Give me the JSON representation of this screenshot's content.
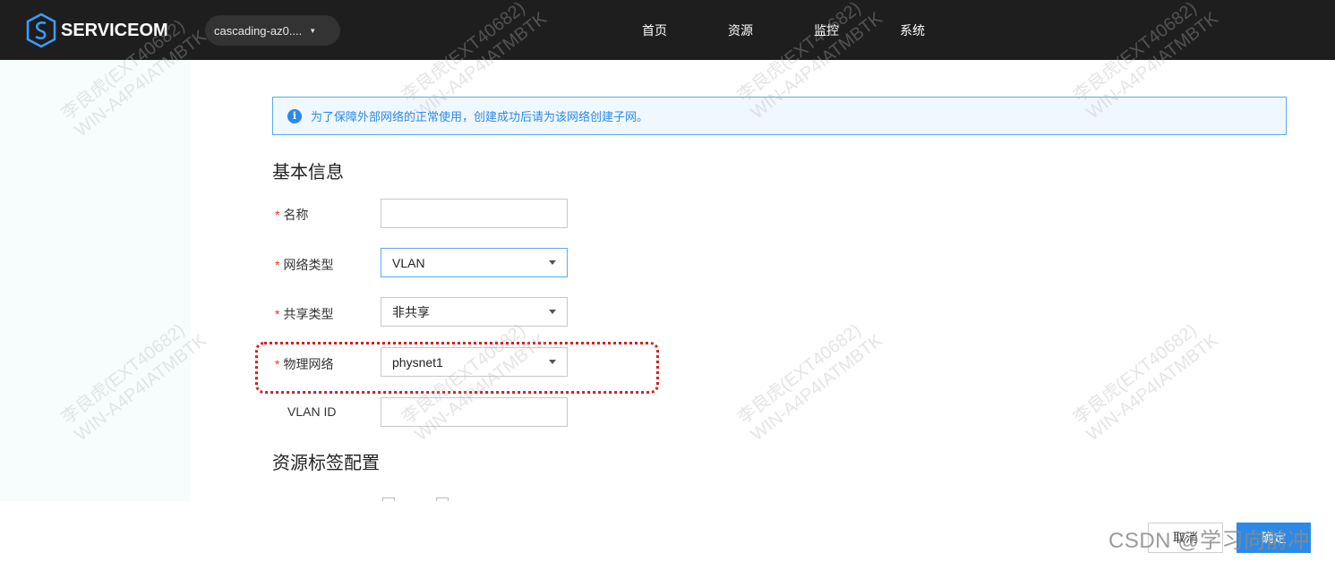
{
  "header": {
    "logo_text": "SERVICEOM",
    "region": "cascading-az0....",
    "nav": [
      "首页",
      "资源",
      "监控",
      "系统"
    ]
  },
  "banner": {
    "icon": "info-icon",
    "text": "为了保障外部网络的正常使用，创建成功后请为该网络创建子网。"
  },
  "sections": {
    "basic_info": "基本信息",
    "resource_tags": "资源标签配置"
  },
  "form": {
    "name_label": "名称",
    "network_type_label": "网络类型",
    "network_type_value": "VLAN",
    "share_type_label": "共享类型",
    "share_type_value": "非共享",
    "physical_network_label": "物理网络",
    "physical_network_value": "physnet1",
    "vlan_id_label": "VLAN ID"
  },
  "footer": {
    "cancel": "取消",
    "ok": "确定",
    "csdn_watermark": "CSDN @学习向前冲"
  },
  "watermark": {
    "line1": "李良虎(EXT40682)",
    "line2": "WIN-A4P4IATMBTK"
  },
  "colors": {
    "accent": "#2b8ae8",
    "topbar": "#1e1e1e",
    "required": "#e0352b",
    "highlight": "#d42020"
  }
}
